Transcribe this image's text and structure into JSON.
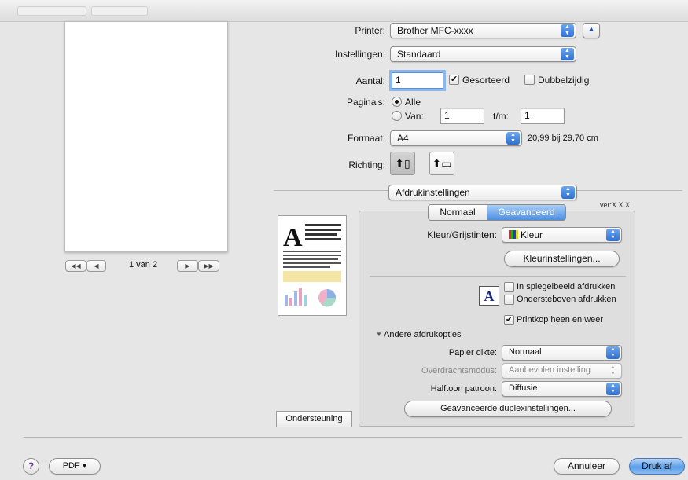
{
  "printer": {
    "label": "Printer:",
    "value": "Brother MFC-xxxx"
  },
  "presets": {
    "label": "Instellingen:",
    "value": "Standaard"
  },
  "copies": {
    "label": "Aantal:",
    "value": "1",
    "collated_label": "Gesorteerd",
    "duplex_label": "Dubbelzijdig"
  },
  "pages": {
    "label": "Pagina's:",
    "all_label": "Alle",
    "from_label": "Van:",
    "from_value": "1",
    "to_label": "t/m:",
    "to_value": "1"
  },
  "paper": {
    "label": "Formaat:",
    "value": "A4",
    "size_text": "20,99 bij 29,70 cm"
  },
  "orientation": {
    "label": "Richting:"
  },
  "pane_selector": {
    "value": "Afdrukinstellingen"
  },
  "version": "ver:X.X.X",
  "tabs": [
    {
      "label": "Normaal"
    },
    {
      "label": "Geavanceerd"
    }
  ],
  "advanced": {
    "color_label": "Kleur/Grijstinten:",
    "color_value": "Kleur",
    "color_settings_button": "Kleurinstellingen...",
    "mirror_label": "In spiegelbeeld afdrukken",
    "reverse_label": "Ondersteboven afdrukken",
    "bidirectional_label": "Printkop heen en weer",
    "other_options_label": "Andere afdrukopties",
    "paper_thickness_label": "Papier dikte:",
    "paper_thickness_value": "Normaal",
    "transfer_mode_label": "Overdrachtsmodus:",
    "transfer_mode_value": "Aanbevolen instelling",
    "halftone_label": "Halftoon patroon:",
    "halftone_value": "Diffusie",
    "duplex_settings_button": "Geavanceerde duplexinstellingen..."
  },
  "preview": {
    "page_text": "1 van 2"
  },
  "support_button": "Ondersteuning",
  "footer": {
    "help": "?",
    "pdf": "PDF ▾",
    "cancel": "Annuleer",
    "print": "Druk af"
  },
  "colors": {
    "accent": "#4d8fe2",
    "background": "#e6e6e6"
  }
}
